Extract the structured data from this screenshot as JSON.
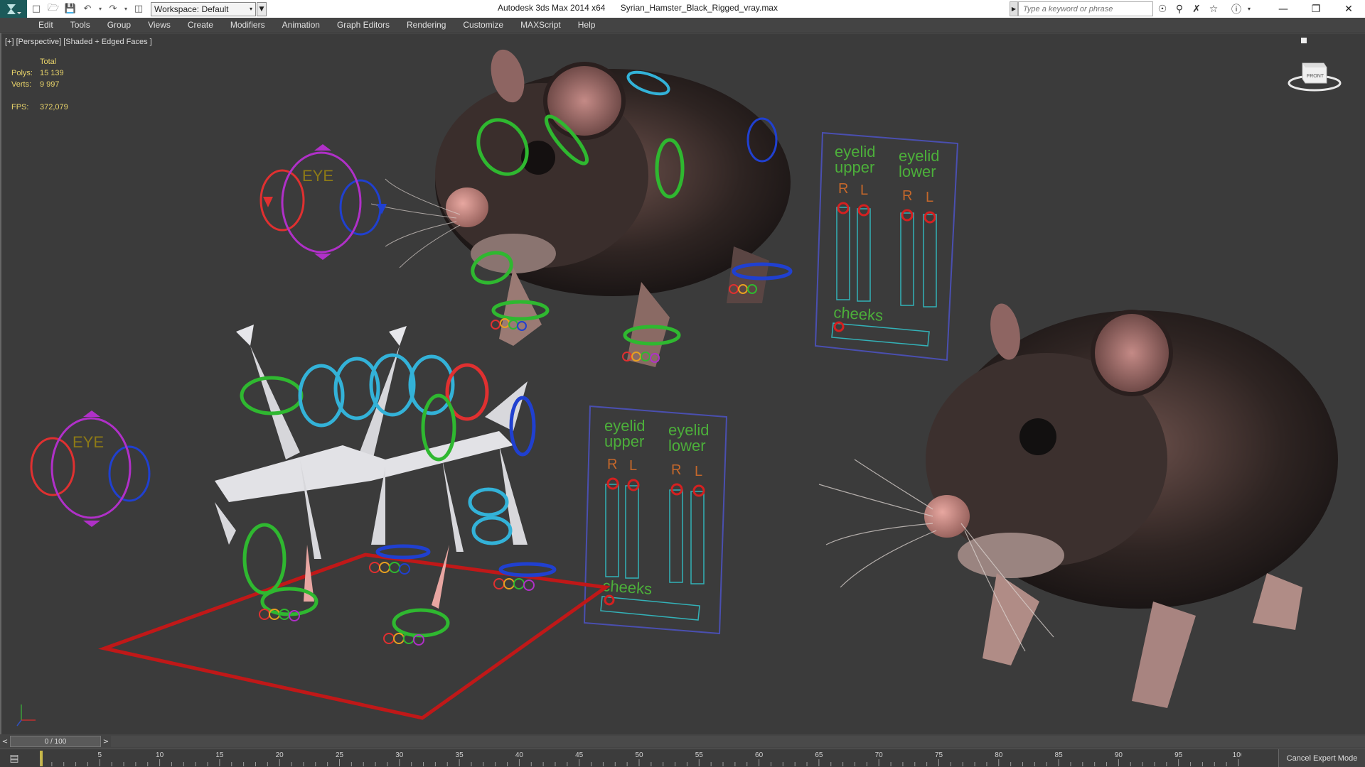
{
  "titlebar": {
    "app_name": "Autodesk 3ds Max  2014 x64",
    "file_name": "Syrian_Hamster_Black_Rigged_vray.max",
    "workspace_label": "Workspace: Default",
    "search_placeholder": "Type a keyword or phrase",
    "icons": [
      "app-logo-icon",
      "new-icon",
      "open-icon",
      "save-icon",
      "undo-icon",
      "redo-icon",
      "project-icon",
      "binoculars-icon",
      "key-icon",
      "star-icon",
      "help-icon",
      "minimize-icon",
      "restore-icon",
      "close-icon"
    ]
  },
  "menu": {
    "items": [
      "Edit",
      "Tools",
      "Group",
      "Views",
      "Create",
      "Modifiers",
      "Animation",
      "Graph Editors",
      "Rendering",
      "Customize",
      "MAXScript",
      "Help"
    ]
  },
  "viewport": {
    "label": "[+] [Perspective] [Shaded + Edged Faces ]",
    "stats": {
      "header": "Total",
      "polys_label": "Polys:",
      "polys_value": "15 139",
      "verts_label": "Verts:",
      "verts_value": "9 997",
      "fps_label": "FPS:",
      "fps_value": "372,079"
    },
    "viewcube_label": "FRONT",
    "scene_labels": {
      "eye": "EYE",
      "eyelid_upper": [
        "eyelid",
        "upper"
      ],
      "eyelid_lower": [
        "eyelid",
        "lower"
      ],
      "r": "R",
      "l": "L",
      "cheeks": "cheeks"
    }
  },
  "timeline": {
    "position": "0 / 100",
    "prev": "<",
    "next": ">",
    "ticks": [
      "5",
      "10",
      "15",
      "20",
      "25",
      "30",
      "35",
      "40",
      "45",
      "50",
      "55",
      "60",
      "65",
      "70",
      "75",
      "80",
      "85",
      "90",
      "95",
      "100"
    ],
    "cancel_expert": "Cancel Expert Mode"
  },
  "colors": {
    "titlebar_bg": "#ffffff",
    "menubar_bg": "#444444",
    "viewport_bg": "#3b3b3b",
    "stats_text": "#e8d36a",
    "panel_green": "#4caf3a",
    "panel_orange": "#c4672b",
    "panel_red": "#d52020",
    "panel_border": "#4a4fb0",
    "ring_green": "#2fb830",
    "ring_blue": "#2040d0",
    "ring_cyan": "#33b2d8",
    "ring_red": "#e03030",
    "ring_magenta": "#b030c8",
    "bone_white": "#e6e6ea",
    "floor_red": "#c01818"
  }
}
